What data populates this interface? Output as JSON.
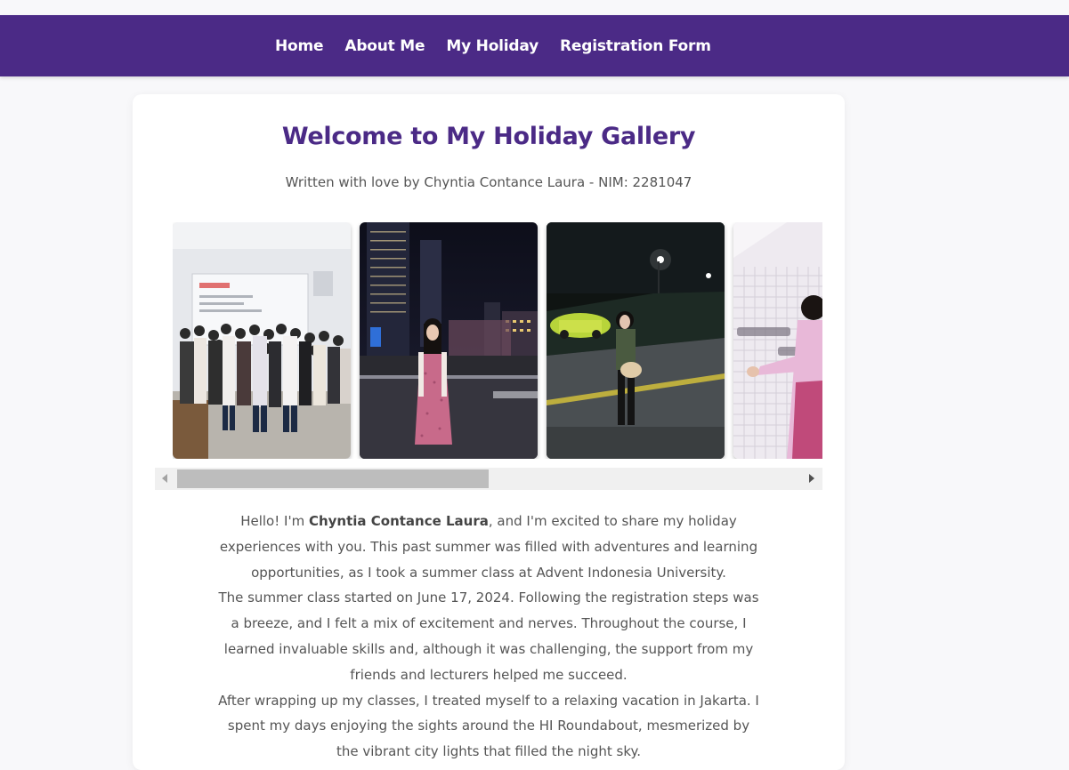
{
  "nav": {
    "items": [
      "Home",
      "About Me",
      "My Holiday",
      "Registration Form"
    ],
    "color": "#4b2a86"
  },
  "page": {
    "title": "Welcome to My Holiday Gallery",
    "subtitle": "Written with love by Chyntia Contance Laura - NIM: 2281047"
  },
  "gallery": {
    "photos": [
      {
        "name": "classroom-group-photo"
      },
      {
        "name": "city-night-photo"
      },
      {
        "name": "street-night-photo"
      },
      {
        "name": "wall-lettering-photo"
      }
    ]
  },
  "story": {
    "p1_before": "Hello! I'm ",
    "p1_name": "Chyntia Contance Laura",
    "p1_after": ", and I'm excited to share my holiday experiences with you. This past summer was filled with adventures and learning opportunities, as I took a summer class at Advent Indonesia University.",
    "p2": "The summer class started on June 17, 2024. Following the registration steps was a breeze, and I felt a mix of excitement and nerves. Throughout the course, I learned invaluable skills and, although it was challenging, the support from my friends and lecturers helped me succeed.",
    "p3": "After wrapping up my classes, I treated myself to a relaxing vacation in Jakarta. I spent my days enjoying the sights around the HI Roundabout, mesmerized by the vibrant city lights that filled the night sky."
  }
}
